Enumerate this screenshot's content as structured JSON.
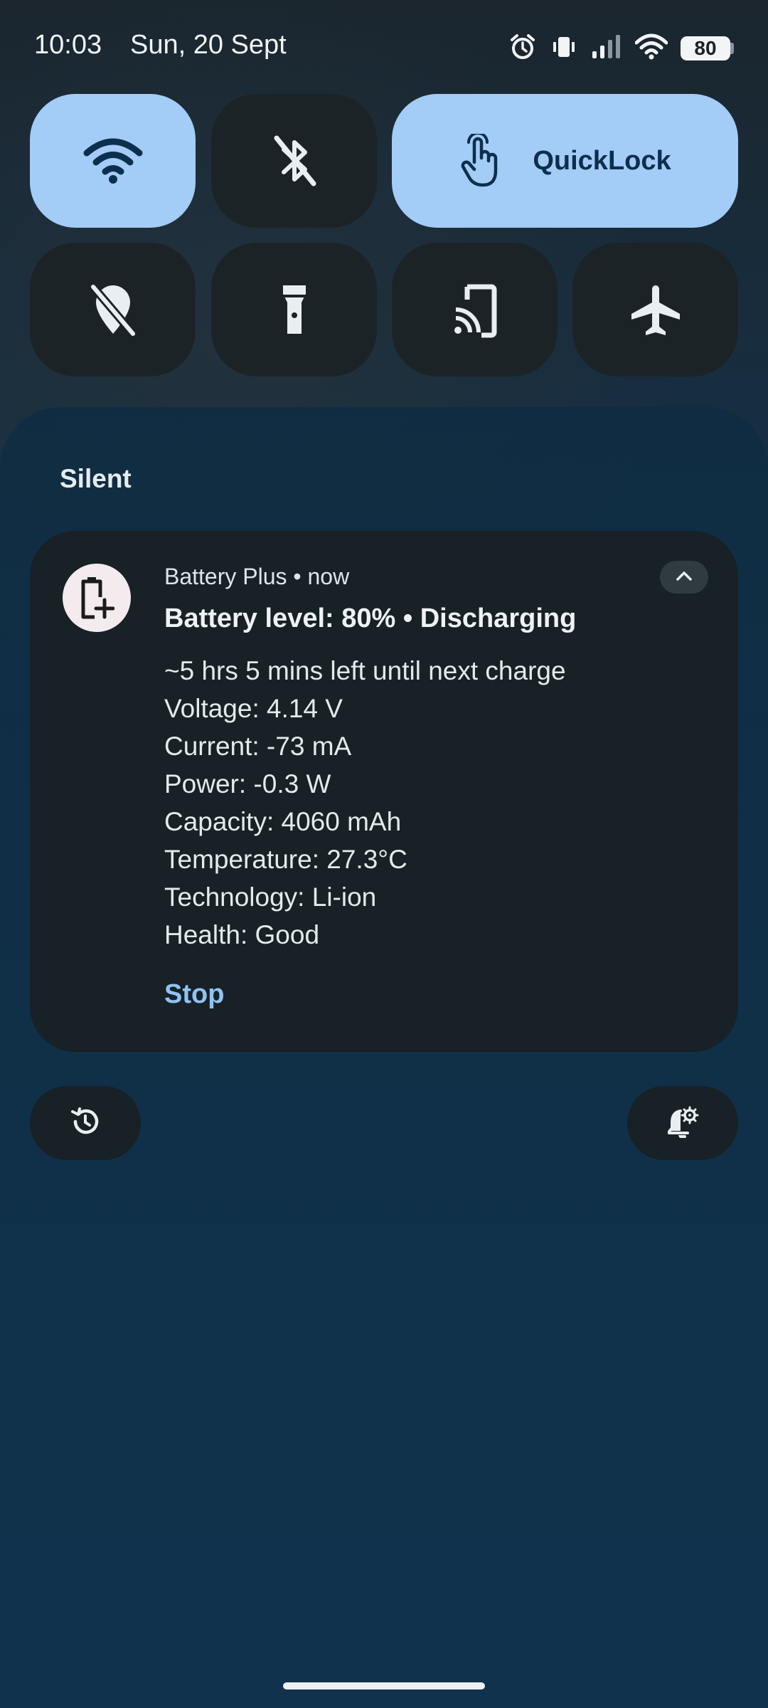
{
  "status_bar": {
    "time": "10:03",
    "date": "Sun, 20 Sept",
    "battery_level": "80",
    "icons": [
      "alarm-icon",
      "vibrate-icon",
      "signal-icon",
      "wifi-icon",
      "battery-icon"
    ]
  },
  "quick_settings": {
    "tiles": [
      {
        "id": "wifi",
        "icon": "wifi-icon",
        "state": "on"
      },
      {
        "id": "bluetooth",
        "icon": "bluetooth-off-icon",
        "state": "off"
      },
      {
        "id": "quicklock",
        "icon": "touch-hand-icon",
        "label": "QuickLock",
        "state": "on"
      },
      {
        "id": "location",
        "icon": "location-off-icon",
        "state": "off"
      },
      {
        "id": "flashlight",
        "icon": "flashlight-icon",
        "state": "off"
      },
      {
        "id": "cast",
        "icon": "cast-icon",
        "state": "off"
      },
      {
        "id": "airplane",
        "icon": "airplane-icon",
        "state": "off"
      }
    ],
    "colors": {
      "on": "#a3ccf7",
      "off": "#1c2327"
    }
  },
  "notifications": {
    "section_title": "Silent",
    "card": {
      "app_name_time": "Battery Plus • now",
      "icon": "battery-plus-icon",
      "title": "Battery level: 80% • Discharging",
      "lines": [
        "~5 hrs 5 mins left until next charge",
        "Voltage: 4.14 V",
        "Current: -73 mA",
        "Power: -0.3 W",
        "Capacity: 4060 mAh",
        "Temperature: 27.3°C",
        "Technology: Li-ion",
        "Health: Good"
      ],
      "action": "Stop"
    }
  },
  "bottom_buttons": {
    "history_icon": "history-icon",
    "settings_icon": "notification-settings-icon"
  },
  "colors": {
    "accent": "#8fc3f3",
    "card_bg": "#172126"
  }
}
